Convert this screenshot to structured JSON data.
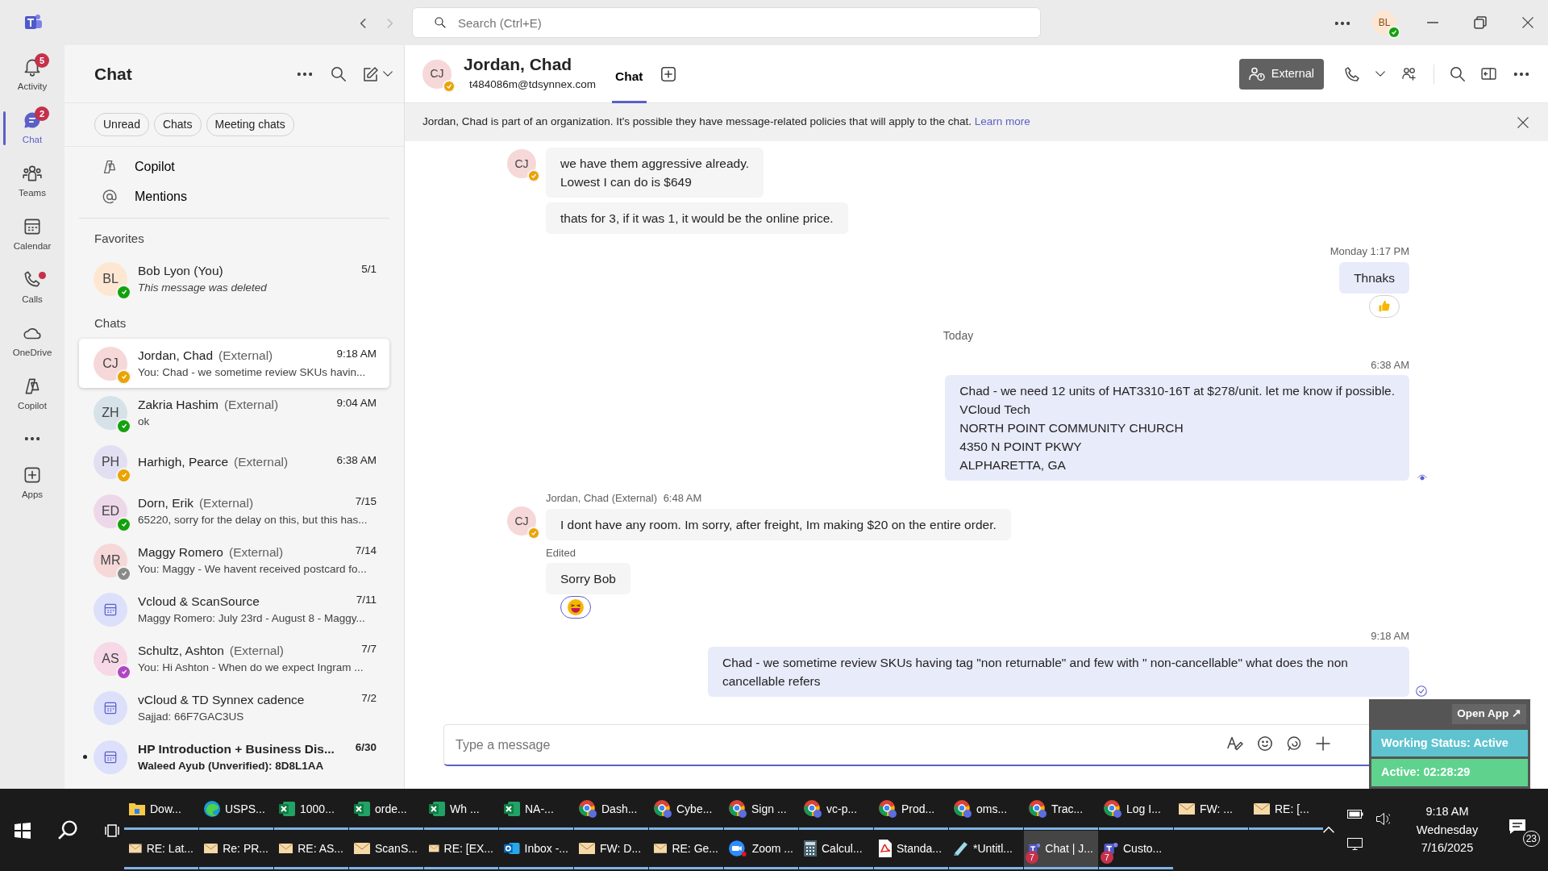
{
  "title_bar": {
    "search_placeholder": "Search (Ctrl+E)",
    "user": {
      "initials": "BL",
      "color": "#13a10e"
    }
  },
  "rail": [
    {
      "label": "Activity",
      "badge": "5",
      "dot": false,
      "selected": false
    },
    {
      "label": "Chat",
      "badge": "2",
      "dot": false,
      "selected": true
    },
    {
      "label": "Teams",
      "dot": false,
      "selected": false
    },
    {
      "label": "Calendar",
      "dot": false,
      "selected": false
    },
    {
      "label": "Calls",
      "dot": true,
      "selected": false
    },
    {
      "label": "OneDrive",
      "dot": false,
      "selected": false
    },
    {
      "label": "Copilot",
      "dot": false,
      "selected": false
    },
    {
      "dot": false,
      "selected": false
    },
    {
      "label": "Apps",
      "dot": false,
      "selected": false
    }
  ],
  "chat_panel": {
    "title": "Chat",
    "filters": [
      "Unread",
      "Chats",
      "Meeting chats"
    ],
    "shortcuts": [
      "Copilot",
      "Mentions"
    ],
    "favorites_heading": "Favorites",
    "favorites": [
      {
        "kind": "person",
        "initials": "BL",
        "name": "Bob Lyon (You)",
        "time": "5/1",
        "preview": "This message was deleted",
        "deleted": true,
        "color": "#13a10e",
        "selected": false,
        "unread": false
      }
    ],
    "chats_heading": "Chats",
    "chats": [
      {
        "kind": "person",
        "initials": "CJ",
        "name": "Jordan, Chad",
        "tag": "(External)",
        "time": "9:18 AM",
        "preview": "You: Chad -  we sometime review SKUs havin...",
        "color": "#eaa300",
        "selected": true,
        "unread": false
      },
      {
        "kind": "person",
        "initials": "ZH",
        "name": "Zakria Hashim",
        "tag": "(External)",
        "time": "9:04 AM",
        "preview": "ok",
        "color": "#13a10e",
        "selected": false,
        "unread": false
      },
      {
        "kind": "person",
        "initials": "PH",
        "name": "Harhigh, Pearce",
        "tag": "(External)",
        "time": "6:38 AM",
        "color": "#eaa300",
        "selected": false,
        "unread": false
      },
      {
        "kind": "person",
        "initials": "ED",
        "name": "Dorn, Erik",
        "tag": "(External)",
        "time": "7/15",
        "preview": "65220, sorry for the delay on this, but this has...",
        "color": "#13a10e",
        "selected": false,
        "unread": false
      },
      {
        "kind": "person",
        "initials": "MR",
        "name": "Maggy Romero",
        "tag": "(External)",
        "time": "7/14",
        "preview": "You: Maggy - We havent received postcard fo...",
        "color": "#8a8a8a",
        "selected": false,
        "unread": false
      },
      {
        "kind": "meeting",
        "name": "Vcloud & ScanSource",
        "time": "7/11",
        "preview": "Maggy Romero: July 23rd - August 8 - Maggy...",
        "selected": false,
        "unread": false
      },
      {
        "kind": "person",
        "initials": "AS",
        "name": "Schultz, Ashton",
        "tag": "(External)",
        "time": "7/7",
        "preview": "You: Hi Ashton -  When do we expect Ingram ...",
        "color": "#b146c2",
        "selected": false,
        "unread": false
      },
      {
        "kind": "meeting",
        "name": "vCloud & TD Synnex cadence",
        "time": "7/2",
        "preview": "Sajjad: 66F7GAC3US",
        "selected": false,
        "unread": false
      },
      {
        "kind": "meeting",
        "name": "HP Introduction + Business Dis...",
        "time": "6/30",
        "preview": "Waleed Ayub (Unverified): 8D8L1AA",
        "selected": false,
        "unread": true
      }
    ]
  },
  "conversation": {
    "initials": "CJ",
    "color": "#eaa300",
    "name": "Jordan, Chad",
    "email": "t484086m@tdsynnex.com",
    "tab": "Chat",
    "external_label": "External",
    "banner": {
      "text": "Jordan, Chad is part of an organization. It's possible they have message-related policies that will apply to the chat.",
      "link": "Learn more"
    },
    "messages": [
      {
        "kind": "incoming",
        "avatar": "CJ",
        "lines": [
          "we have them aggressive already.",
          "Lowest I can do is $649"
        ]
      },
      {
        "kind": "incoming",
        "lines": [
          "thats for 3, if it was 1, it would be the online price."
        ]
      },
      {
        "kind": "outgoing",
        "time": "Monday 1:17 PM",
        "lines": [
          "Thnaks"
        ],
        "reaction": {
          "kind": "like"
        }
      },
      {
        "kind": "divider",
        "text": "Today"
      },
      {
        "kind": "outgoing",
        "time": "6:38 AM",
        "lines": [
          "Chad -  we need 12 units of HAT3310-16T at $278/unit. let me know if possible.",
          "VCloud Tech",
          "NORTH POINT COMMUNITY CHURCH",
          "4350 N POINT PKWY",
          "ALPHARETTA, GA"
        ],
        "seen": true
      },
      {
        "kind": "incoming",
        "avatar": "CJ",
        "sender": "Jordan, Chad (External)",
        "time": "6:48 AM",
        "lines": [
          "I dont have any room.  Im sorry, after freight, Im making $20 on the entire order."
        ]
      },
      {
        "kind": "incoming",
        "edited": "Edited",
        "lines": [
          "Sorry Bob"
        ],
        "reaction": {
          "kind": "laugh"
        }
      },
      {
        "kind": "outgoing",
        "time": "9:18 AM",
        "lines": [
          "Chad -  we sometime review SKUs having tag \"non returnable\" and few with \" non-cancellable\" what does the non cancellable refers"
        ],
        "read": true
      }
    ],
    "compose_placeholder": "Type a message"
  },
  "widget": {
    "open_app": "Open App ↗",
    "status": "Working Status: Active",
    "timer": "Active: 02:28:29"
  },
  "taskbar": {
    "rows": [
      [
        {
          "kind": "folder",
          "label": "Dow..."
        },
        {
          "kind": "edge",
          "label": "USPS..."
        },
        {
          "kind": "excel",
          "label": "1000..."
        },
        {
          "kind": "excel",
          "label": "orde..."
        },
        {
          "kind": "excel",
          "label": "Wh ..."
        },
        {
          "kind": "excel",
          "label": "NA-..."
        },
        {
          "kind": "chrome",
          "label": "Dash..."
        },
        {
          "kind": "chrome",
          "label": "Cybe..."
        },
        {
          "kind": "chrome",
          "label": "Sign ..."
        },
        {
          "kind": "chrome",
          "label": "vc-p..."
        },
        {
          "kind": "chrome",
          "label": "Prod..."
        },
        {
          "kind": "chrome",
          "label": "oms..."
        },
        {
          "kind": "chrome",
          "label": "Trac..."
        },
        {
          "kind": "chrome",
          "label": "Log I..."
        },
        {
          "kind": "mail",
          "label": "FW: ..."
        },
        {
          "kind": "mail",
          "label": "RE: [..."
        }
      ],
      [
        {
          "kind": "mail",
          "label": "RE: Lat..."
        },
        {
          "kind": "mail",
          "label": "Re: PR..."
        },
        {
          "kind": "mail",
          "label": "RE: AS..."
        },
        {
          "kind": "mail",
          "label": "ScanS..."
        },
        {
          "kind": "mail",
          "label": "RE: [EX..."
        },
        {
          "kind": "outlook",
          "label": "Inbox -..."
        },
        {
          "kind": "mail",
          "label": "FW: D..."
        },
        {
          "kind": "mail",
          "label": "RE: Ge..."
        },
        {
          "kind": "zoom",
          "label": "Zoom ..."
        },
        {
          "kind": "calc",
          "label": "Calcul..."
        },
        {
          "kind": "pdf",
          "label": "Standa..."
        },
        {
          "kind": "paint",
          "label": "*Untitl..."
        },
        {
          "kind": "teams",
          "label": "Chat | J...",
          "badge": "7",
          "selected": true
        },
        {
          "kind": "teams",
          "label": "Custo...",
          "badge": "7",
          "selected": false
        }
      ]
    ],
    "clock": {
      "time": "9:18 AM",
      "day": "Wednesday",
      "date": "7/16/2025"
    },
    "notifications": "23"
  }
}
